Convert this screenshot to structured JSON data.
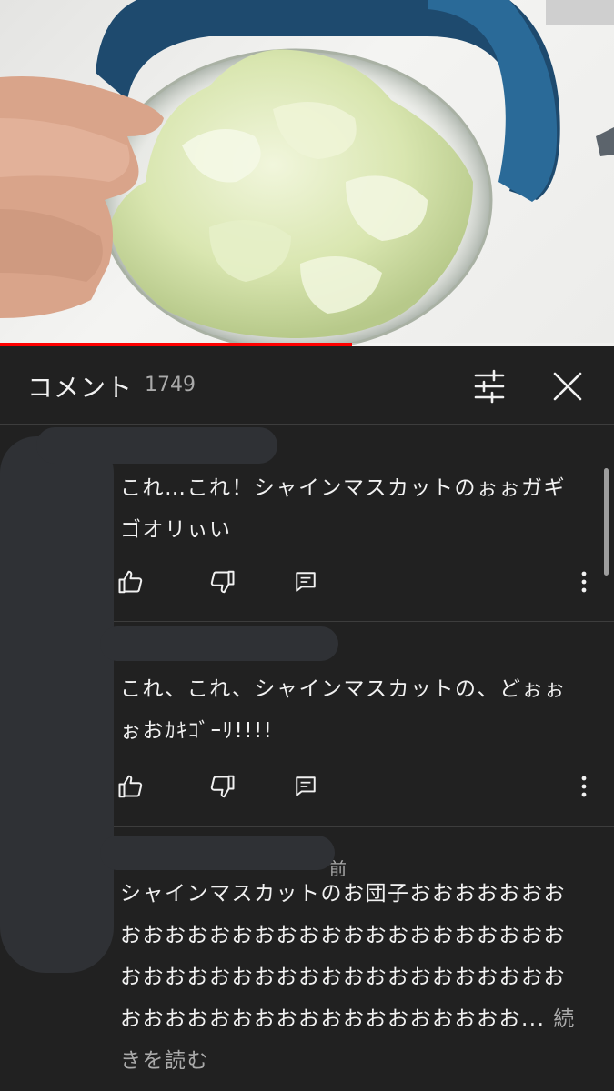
{
  "video": {
    "progress_fraction": 0.573
  },
  "header": {
    "title": "コメント",
    "count": "1749",
    "filter_icon": "sliders-icon",
    "close_icon": "close-icon"
  },
  "comments": [
    {
      "meta": "",
      "text": "これ…これ！シャインマスカットのぉぉガギゴオリぃい",
      "like_icon": "thumb-up-icon",
      "dislike_icon": "thumb-down-icon",
      "reply_icon": "reply-icon",
      "more_icon": "more-vert-icon"
    },
    {
      "meta": "",
      "text": "これ、これ、シャインマスカットの、どぉぉぉおｶｷｺﾞｰﾘ!!!!",
      "like_icon": "thumb-up-icon",
      "dislike_icon": "thumb-down-icon",
      "reply_icon": "reply-icon",
      "more_icon": "more-vert-icon"
    },
    {
      "meta": "前",
      "text": "シャインマスカットのお団子おおおおおおおおおおおおおおおおおおおおおおおおおおおおおおおおおおおおおおおおおおおおおおおおおおおおおおおおおおおおおおおおお...",
      "read_more": "続きを読む"
    }
  ],
  "colors": {
    "background": "#212121",
    "progress": "#ff0000",
    "divider": "#3d3d3d",
    "secondary_text": "#aaaaaa"
  }
}
